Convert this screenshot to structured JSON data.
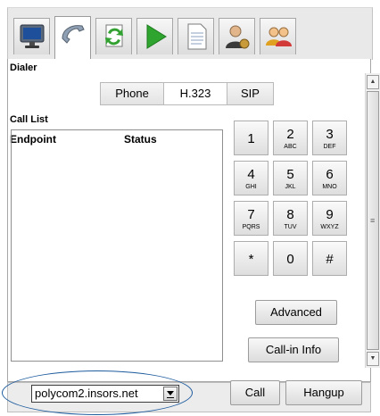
{
  "tabs": [
    {
      "icon": "monitor-icon"
    },
    {
      "icon": "phone-handset-icon"
    },
    {
      "icon": "refresh-document-icon"
    },
    {
      "icon": "play-icon"
    },
    {
      "icon": "document-icon"
    },
    {
      "icon": "user-settings-icon"
    },
    {
      "icon": "users-icon"
    }
  ],
  "dialer": {
    "title": "Dialer",
    "modes": [
      "Phone",
      "H.323",
      "SIP"
    ],
    "selected_mode": "H.323"
  },
  "call_list": {
    "title": "Call List",
    "columns": [
      "Endpoint",
      "Status"
    ]
  },
  "keypad": [
    {
      "digit": "1",
      "letters": ""
    },
    {
      "digit": "2",
      "letters": "ABC"
    },
    {
      "digit": "3",
      "letters": "DEF"
    },
    {
      "digit": "4",
      "letters": "GHI"
    },
    {
      "digit": "5",
      "letters": "JKL"
    },
    {
      "digit": "6",
      "letters": "MNO"
    },
    {
      "digit": "7",
      "letters": "PQRS"
    },
    {
      "digit": "8",
      "letters": "TUV"
    },
    {
      "digit": "9",
      "letters": "WXYZ"
    },
    {
      "digit": "*",
      "letters": ""
    },
    {
      "digit": "0",
      "letters": ""
    },
    {
      "digit": "#",
      "letters": ""
    }
  ],
  "buttons": {
    "advanced": "Advanced",
    "callin_info": "Call-in Info",
    "call": "Call",
    "hangup": "Hangup"
  },
  "endpoint_select": {
    "value": "polycom2.insors.net"
  },
  "colors": {
    "highlight_ellipse": "#1e5c9e",
    "play_green": "#2fa52f"
  }
}
